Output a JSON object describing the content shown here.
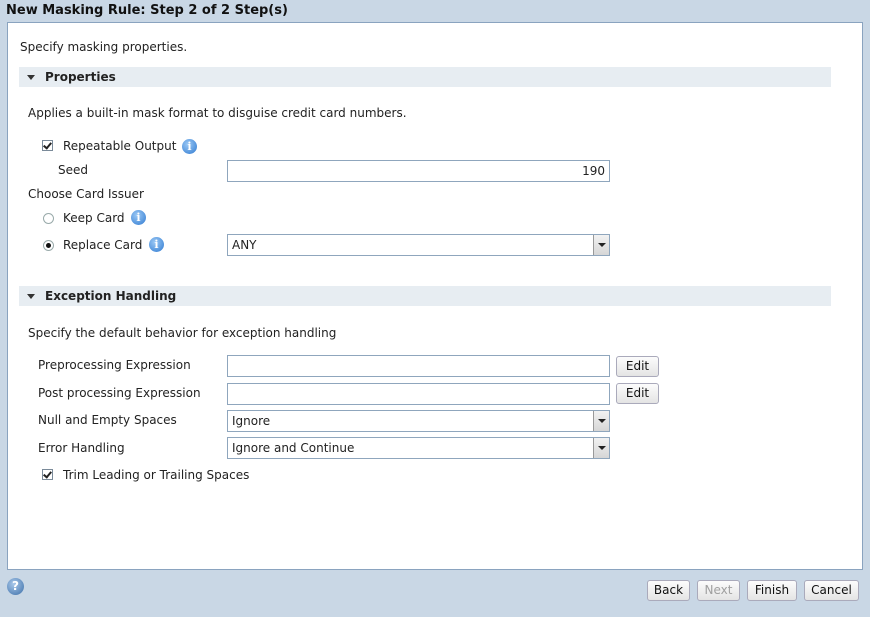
{
  "window": {
    "title": "New Masking Rule: Step 2 of 2 Step(s)"
  },
  "intro": "Specify masking properties.",
  "properties": {
    "header": "Properties",
    "description": "Applies a built-in mask format to disguise credit card numbers.",
    "repeatable_output": {
      "label": "Repeatable Output",
      "checked": true
    },
    "seed": {
      "label": "Seed",
      "value": "190"
    },
    "card_issuer": {
      "label": "Choose Card Issuer",
      "keep_card": {
        "label": "Keep Card",
        "selected": false
      },
      "replace_card": {
        "label": "Replace Card",
        "selected": true,
        "value": "ANY"
      }
    }
  },
  "exception_handling": {
    "header": "Exception Handling",
    "description": "Specify the default behavior for exception handling",
    "preprocessing": {
      "label": "Preprocessing Expression",
      "value": "",
      "edit_label": "Edit"
    },
    "postprocessing": {
      "label": "Post processing Expression",
      "value": "",
      "edit_label": "Edit"
    },
    "null_empty": {
      "label": "Null and Empty Spaces",
      "value": "Ignore"
    },
    "error_handling": {
      "label": "Error Handling",
      "value": "Ignore and Continue"
    },
    "trim": {
      "label": "Trim Leading or Trailing Spaces",
      "checked": true
    }
  },
  "footer": {
    "help_glyph": "?",
    "back": "Back",
    "next": "Next",
    "finish": "Finish",
    "cancel": "Cancel"
  },
  "icons": {
    "info_glyph": "i"
  }
}
